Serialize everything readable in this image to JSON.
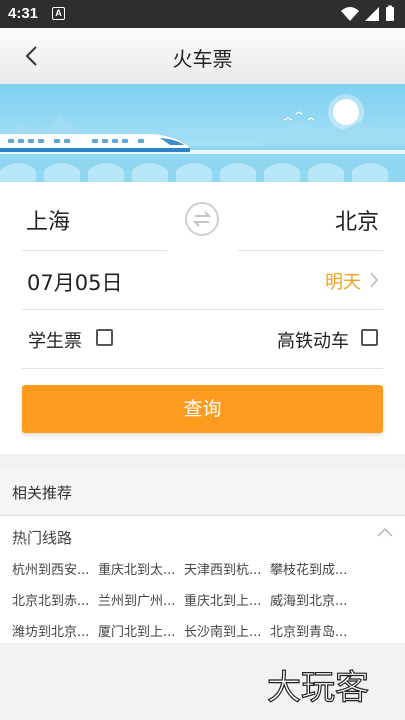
{
  "status_bar": {
    "time": "4:31",
    "notif_icon_letter": "A",
    "icons": [
      "wifi-icon",
      "signal-icon",
      "battery-icon"
    ]
  },
  "header": {
    "title": "火车票",
    "back_icon": "chevron-left-icon"
  },
  "form": {
    "from_city": "上海",
    "to_city": "北京",
    "swap_icon": "swap-arrows-icon",
    "date": "07月05日",
    "date_relative": "明天",
    "student_ticket_label": "学生票",
    "student_ticket_checked": false,
    "gaotie_label": "高铁动车",
    "gaotie_checked": false,
    "search_label": "查询"
  },
  "recommend": {
    "title": "相关推荐",
    "hot_routes_title": "热门线路",
    "routes": [
      [
        "杭州到西安...",
        "重庆北到太...",
        "天津西到杭...",
        "攀枝花到成..."
      ],
      [
        "北京北到赤...",
        "兰州到广州...",
        "重庆北到上...",
        "威海到北京..."
      ],
      [
        "潍坊到北京...",
        "厦门北到上...",
        "长沙南到上...",
        "北京到青岛..."
      ]
    ]
  },
  "watermark": "大玩客",
  "colors": {
    "accent": "#fd9b1f",
    "relative_date": "#f5a021",
    "banner_sky": "#7fd0f2"
  }
}
